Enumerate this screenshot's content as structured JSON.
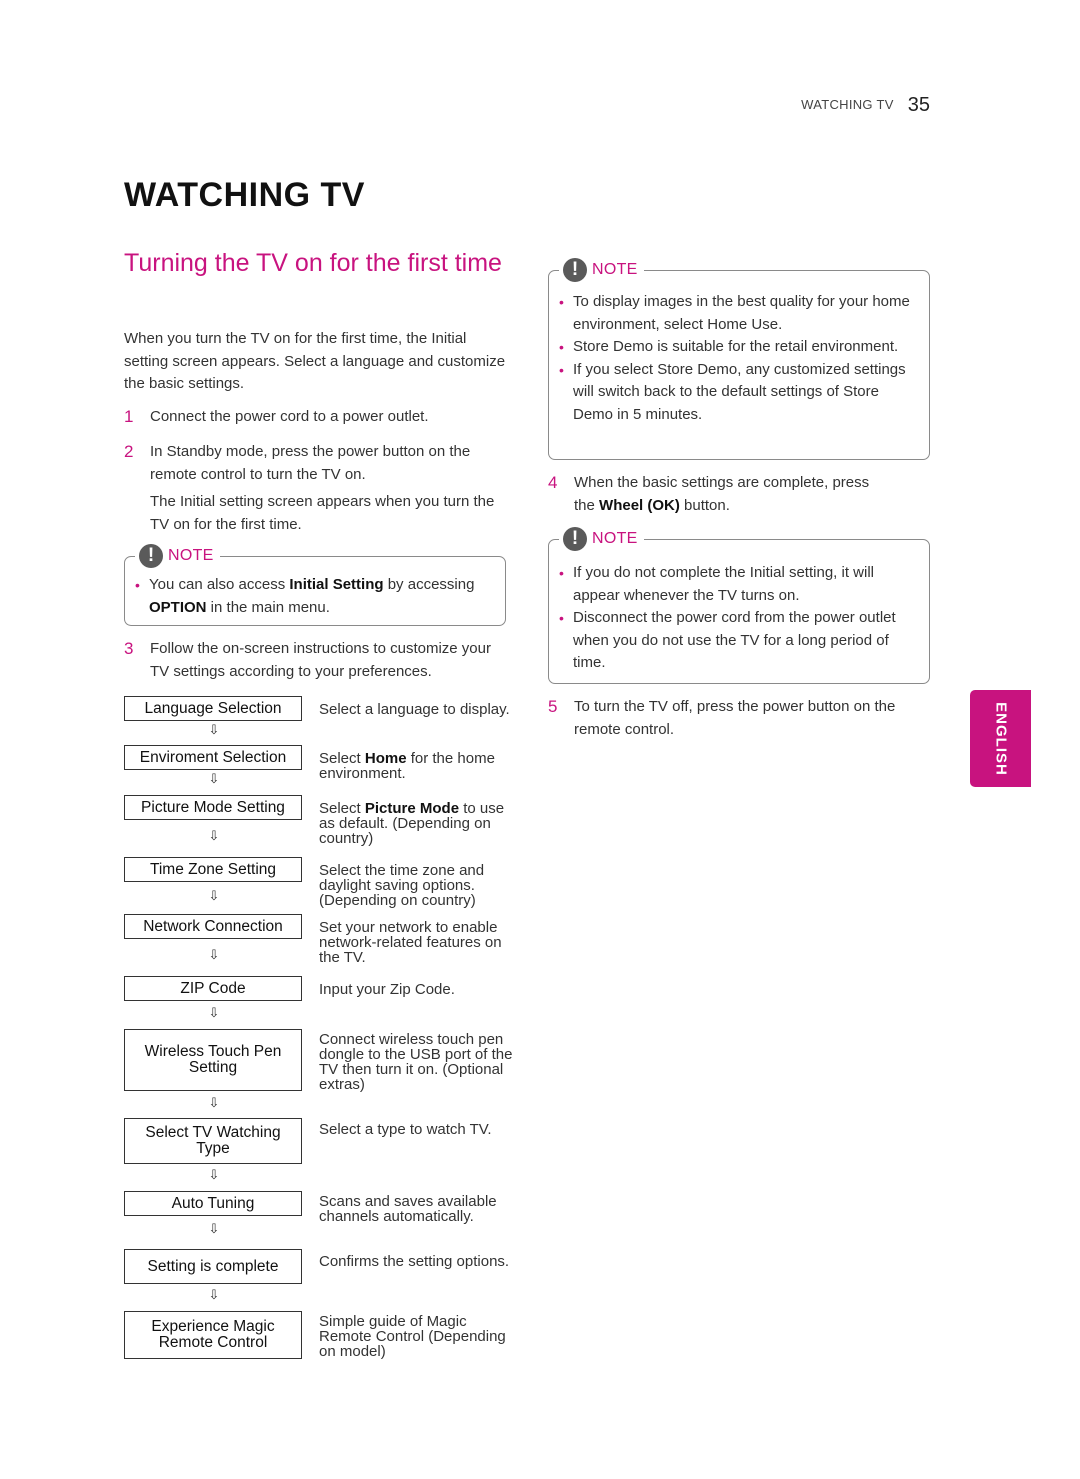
{
  "header": {
    "section": "WATCHING TV",
    "page_number": "35"
  },
  "page_title": "WATCHING TV",
  "section_title": "Turning the TV on for the first time",
  "intro": "When you turn the TV on for the first time, the Initial setting screen appears. Select a language and customize the basic settings.",
  "steps": [
    {
      "num": "1",
      "text": "Connect the power cord to a power outlet."
    },
    {
      "num": "2",
      "text": "In Standby mode, press the power button on the remote control to turn the TV on.",
      "subtext": "The Initial setting screen appears when you turn the TV on for the first time."
    },
    {
      "num": "3",
      "text": "Follow the on-screen instructions to customize your TV settings according to your preferences."
    },
    {
      "num": "4",
      "text_pre": "When the basic settings are complete, press the ",
      "text_bold": "Wheel (OK)",
      "text_post": " button."
    },
    {
      "num": "5",
      "text": "To turn the TV off, press the power button on the remote control."
    }
  ],
  "note_label": "NOTE",
  "note_icon": "exclamation-icon",
  "note1": {
    "pre": "You can also access ",
    "b1": "Initial Setting",
    "mid": " by accessing ",
    "b2": "OPTION",
    "post": " in the main menu."
  },
  "note2": {
    "items": [
      "To display images in the best quality for your home environment, select Home Use.",
      "Store Demo is suitable for the retail environment.",
      "If you select Store Demo, any customized settings will switch back to the default settings of Store Demo in 5 minutes."
    ]
  },
  "note3": {
    "items": [
      "If you do not complete the Initial setting, it will appear whenever the TV turns on.",
      "Disconnect the power cord from the power outlet when you do not use the TV for a long period of time."
    ]
  },
  "flow_arrow": "⇩",
  "flow": [
    {
      "box": "Language Selection",
      "desc": "Select a language to display."
    },
    {
      "box": "Enviroment Selection",
      "desc_pre": "Select ",
      "desc_bold": "Home",
      "desc_post": " for the home environment."
    },
    {
      "box": "Picture Mode Setting",
      "desc_pre": "Select ",
      "desc_bold": "Picture Mode",
      "desc_post": " to use as default. (Depending on country)"
    },
    {
      "box": "Time Zone Setting",
      "desc": "Select the time zone and daylight saving options. (Depending on country)"
    },
    {
      "box": "Network Connection",
      "desc": "Set your network to enable network-related features on the TV."
    },
    {
      "box": "ZIP Code",
      "desc": "Input your Zip Code."
    },
    {
      "box": "Wireless Touch Pen Setting",
      "desc": "Connect wireless touch pen dongle to the USB port of the TV then turn it on. (Optional extras)"
    },
    {
      "box": "Select TV Watching Type",
      "desc": "Select a type to watch TV."
    },
    {
      "box": "Auto Tuning",
      "desc": "Scans and saves available channels automatically."
    },
    {
      "box": "Setting is complete",
      "desc": "Confirms the setting options."
    },
    {
      "box": "Experience Magic Remote Control",
      "desc": "Simple guide of Magic Remote Control (Depending on model)"
    }
  ],
  "language_tab": "ENGLISH",
  "colors": {
    "accent": "#c8137f",
    "text": "#333333",
    "icon": "#5a5a5a"
  }
}
